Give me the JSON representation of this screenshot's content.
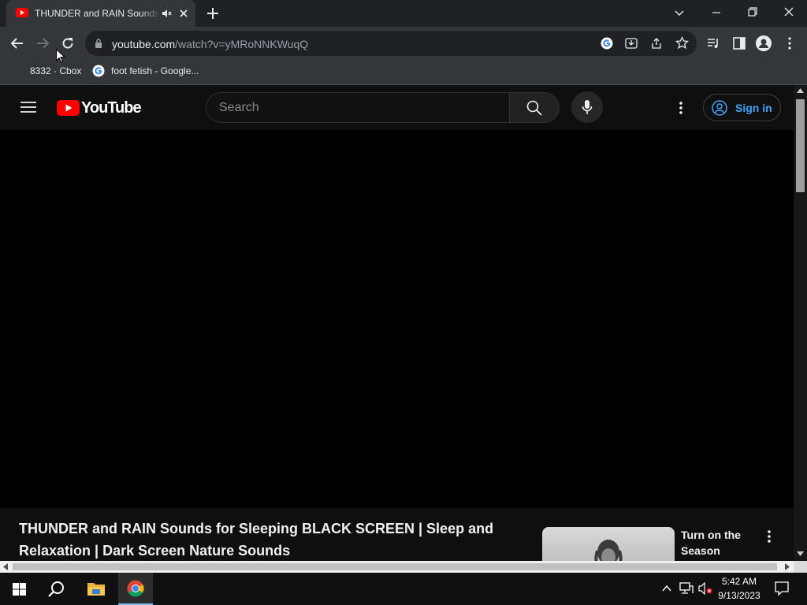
{
  "browser": {
    "tab_title": "THUNDER and RAIN Sounds for Sleeping BLACK SCREEN",
    "url_host": "youtube.com",
    "url_path": "/watch?v=yMRoNNKWuqQ",
    "bookmarks": [
      {
        "label": "8332 · Cbox"
      },
      {
        "label": "foot fetish - Google..."
      }
    ]
  },
  "youtube": {
    "logo_text": "YouTube",
    "search_placeholder": "Search",
    "signin_label": "Sign in",
    "video_title": "THUNDER and RAIN Sounds for Sleeping BLACK SCREEN | Sleep and Relaxation | Dark Screen Nature Sounds",
    "promo_title": "Turn on the Season"
  },
  "taskbar": {
    "time": "5:42 AM",
    "date": "9/13/2023"
  },
  "colors": {
    "accent_red": "#ff0000",
    "link_blue": "#3ea6ff",
    "chrome_bg": "#35363a"
  }
}
